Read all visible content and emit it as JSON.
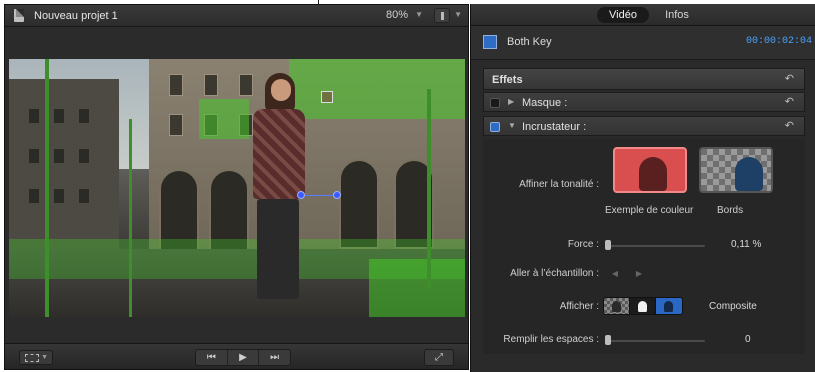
{
  "viewer": {
    "project_title": "Nouveau projet 1",
    "zoom": "80%",
    "zoom_arrow": "▼",
    "view_arrow": "▼",
    "transform_arrow": "▼",
    "transport": {
      "prev": "⏮",
      "play": "▶",
      "next": "⏭"
    },
    "fullscreen": "⤢"
  },
  "inspector": {
    "tabs": [
      {
        "label": "Vidéo",
        "active": true
      },
      {
        "label": "Infos",
        "active": false
      }
    ],
    "clip_name": "Both Key",
    "timecode": "00:00:02:04",
    "effects_label": "Effets",
    "masque_label": "Masque :",
    "incrustateur_label": "Incrustateur :",
    "reset_glyph": "↶",
    "params": {
      "affiner_label": "Affiner la tonalité :",
      "swatch_color_label": "Exemple de couleur",
      "swatch_edges_label": "Bords",
      "force_label": "Force :",
      "force_value": "0,11 %",
      "force_level": 0.0011,
      "aller_label": "Aller à l’échantillon :",
      "afficher_label": "Afficher :",
      "afficher_value": "Composite",
      "remplir_label": "Remplir les espaces :",
      "remplir_value": "0",
      "remplir_level": 0
    }
  },
  "colors": {
    "accent_blue": "#2f6cc4",
    "timecode_blue": "#4aa3ff",
    "green_screen_spill": "#46c828"
  }
}
